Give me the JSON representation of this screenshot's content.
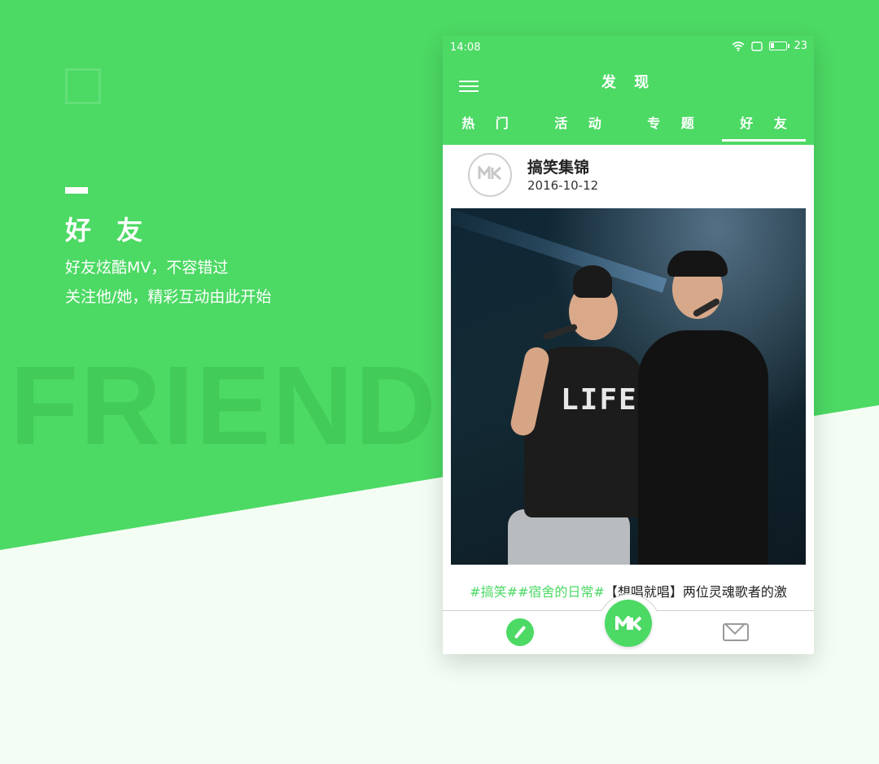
{
  "hero": {
    "title": "好 友",
    "line1": "好友炫酷MV，不容错过",
    "line2": "关注他/她，精彩互动由此开始",
    "watermark": "FRIEND"
  },
  "status_bar": {
    "time": "14:08",
    "battery": "23",
    "battery_level": 0.23
  },
  "app": {
    "title": "发 现",
    "tabs": [
      {
        "label": "热 门"
      },
      {
        "label": "活 动"
      },
      {
        "label": "专 题"
      },
      {
        "label": "好 友",
        "active": true
      }
    ]
  },
  "post": {
    "author": "搞笑集锦",
    "date": "2016-10-12",
    "image_shirt_text": "LIFE",
    "caption_tags": "#搞笑##宿舍的日常#",
    "caption_text": "【想唱就唱】两位灵魂歌者的激"
  },
  "bottom_nav": {
    "left_icon": "compass-icon",
    "center_icon": "mv-logo-icon",
    "right_icon": "mail-icon"
  },
  "colors": {
    "brand_green": "#4cd964",
    "background": "#f4fdf4"
  }
}
